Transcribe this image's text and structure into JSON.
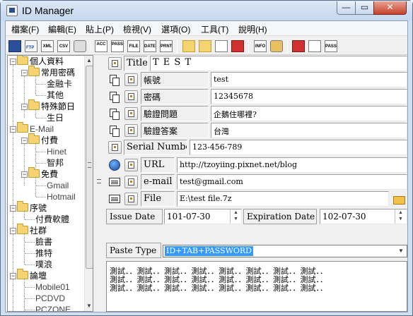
{
  "window": {
    "title": "ID Manager",
    "min_glyph": "—",
    "max_glyph": "▭",
    "close_glyph": "✕"
  },
  "menu": [
    "檔案(F)",
    "編輯(E)",
    "貼上(P)",
    "檢視(V)",
    "選項(O)",
    "工具(T)",
    "說明(H)"
  ],
  "toolbar": {
    "icons": [
      "save-icon",
      "ftp-upload-icon",
      "xml-export-icon",
      "csv-export-icon",
      "print-icon",
      "acc-list-icon",
      "pass-list-icon",
      "file-icon",
      "date-icon",
      "print-preview-icon",
      "new-folder-icon",
      "new-subfolder-icon",
      "new-item-icon",
      "delete-icon",
      "info-icon",
      "key-icon",
      "window-icon",
      "note-icon",
      "pass-text-icon"
    ],
    "labels": {
      "ftp": "FTP",
      "xml": "XML",
      "csv": "CSV",
      "acc": "ACC",
      "pass": "PASS",
      "file": "FILE",
      "date": "DATE",
      "prnt": "PRNT",
      "info": "INFO",
      "pass2": "PASS"
    }
  },
  "tree": [
    {
      "label": "個人資料",
      "level": 0,
      "type": "folder",
      "expanded": true
    },
    {
      "label": "常用密碼",
      "level": 1,
      "type": "folder",
      "expanded": true
    },
    {
      "label": "金融卡",
      "level": 2,
      "type": "leaf"
    },
    {
      "label": "其他",
      "level": 2,
      "type": "leaf"
    },
    {
      "label": "特殊節日",
      "level": 1,
      "type": "folder",
      "expanded": true
    },
    {
      "label": "生日",
      "level": 2,
      "type": "leaf"
    },
    {
      "label": "E-Mail",
      "level": 0,
      "type": "folder",
      "expanded": true
    },
    {
      "label": "付費",
      "level": 1,
      "type": "folder",
      "expanded": true
    },
    {
      "label": "Hinet",
      "level": 2,
      "type": "leaf"
    },
    {
      "label": "智邦",
      "level": 2,
      "type": "leaf"
    },
    {
      "label": "免費",
      "level": 1,
      "type": "folder",
      "expanded": true
    },
    {
      "label": "Gmail",
      "level": 2,
      "type": "leaf"
    },
    {
      "label": "Hotmail",
      "level": 2,
      "type": "leaf"
    },
    {
      "label": "序號",
      "level": 0,
      "type": "folder",
      "expanded": true
    },
    {
      "label": "付費軟體",
      "level": 1,
      "type": "leaf"
    },
    {
      "label": "社群",
      "level": 0,
      "type": "folder",
      "expanded": true
    },
    {
      "label": "臉書",
      "level": 1,
      "type": "leaf"
    },
    {
      "label": "推特",
      "level": 1,
      "type": "leaf"
    },
    {
      "label": "噗浪",
      "level": 1,
      "type": "leaf"
    },
    {
      "label": "論壇",
      "level": 0,
      "type": "folder",
      "expanded": true
    },
    {
      "label": "Mobile01",
      "level": 1,
      "type": "leaf"
    },
    {
      "label": "PCDVD",
      "level": 1,
      "type": "leaf"
    },
    {
      "label": "PCZONE",
      "level": 1,
      "type": "leaf"
    }
  ],
  "detail": {
    "title_label": "Title",
    "title_value": "T E S T",
    "account_label": "帳號",
    "account_value": "test",
    "password_label": "密碼",
    "password_value": "12345678",
    "question_label": "驗證問題",
    "question_value": "企鵝住哪裡?",
    "answer_label": "驗證答案",
    "answer_value": "台灣",
    "serial_label": "Serial Number",
    "serial_value": "123-456-789",
    "url_label": "URL",
    "url_value": "http://tzoyiing.pixnet.net/blog",
    "email_label": "e-mail",
    "email_value": "test@gmail.com",
    "file_label": "File",
    "file_value": "E:\\test file.7z",
    "issue_label": "Issue Date",
    "issue_value": "101-07-30",
    "expiration_label": "Expiration Date",
    "expiration_value": "102-07-30",
    "paste_label": "Paste Type",
    "paste_value": "ID+TAB+PASSWORD",
    "memo": "測試．．測試．．測試．．測試．．測試．．測試．．測試．．測試．．\n測試．．測試．．測試．．測試．．測試．．測試．．測試．．測試．．\n測試．．測試．．測試．．測試．．測試．．測試．．測試．．測試．．"
  }
}
